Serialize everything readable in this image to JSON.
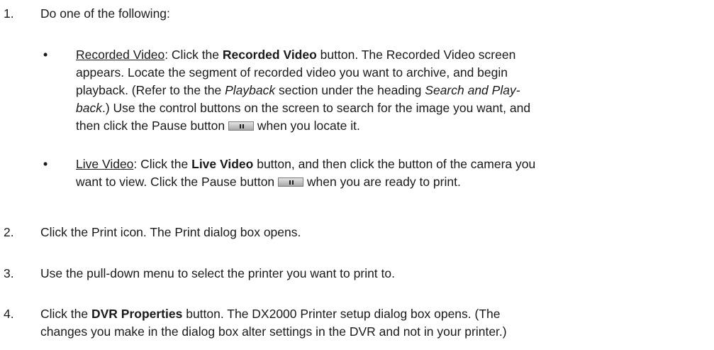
{
  "steps": [
    {
      "num": "1.",
      "text": "Do one of the following:"
    },
    {
      "num": "2.",
      "text": "Click the Print icon. The Print dialog box opens."
    },
    {
      "num": "3.",
      "text": "Use the pull-down menu to select the printer you want to print to."
    },
    {
      "num": "4.",
      "pre": "Click the ",
      "bold": "DVR Properties",
      "post1": " button. The DX2000 Printer setup dialog box opens. (The",
      "post2": "changes you make in the dialog box alter settings in the DVR and not in your printer.)"
    }
  ],
  "bullets": [
    {
      "dot": "•",
      "link": "Recorded Video",
      "l1_a": ": Click the ",
      "l1_bold": "Recorded Video",
      "l1_b": " button. The Recorded Video screen",
      "l2": "appears. Locate the segment of recorded video you want to archive, and begin",
      "l3_a": "playback. (Refer to the the ",
      "l3_i1": "Playback",
      "l3_b": " section under the heading ",
      "l3_i2": "Search and Play-",
      "l4_i": "back",
      "l4_b": ".) Use the control buttons on the screen to search for the image you want, and",
      "l5_a": "then click the Pause button ",
      "l5_b": " when you locate it."
    },
    {
      "dot": "•",
      "link": "Live Video",
      "l1_a": ": Click the ",
      "l1_bold": "Live Video",
      "l1_b": " button, and then click the button of the camera you",
      "l2_a": "want to view. Click the Pause button ",
      "l2_b": " when you are ready to print."
    }
  ],
  "icons": {
    "pause": "pause-button-icon"
  }
}
